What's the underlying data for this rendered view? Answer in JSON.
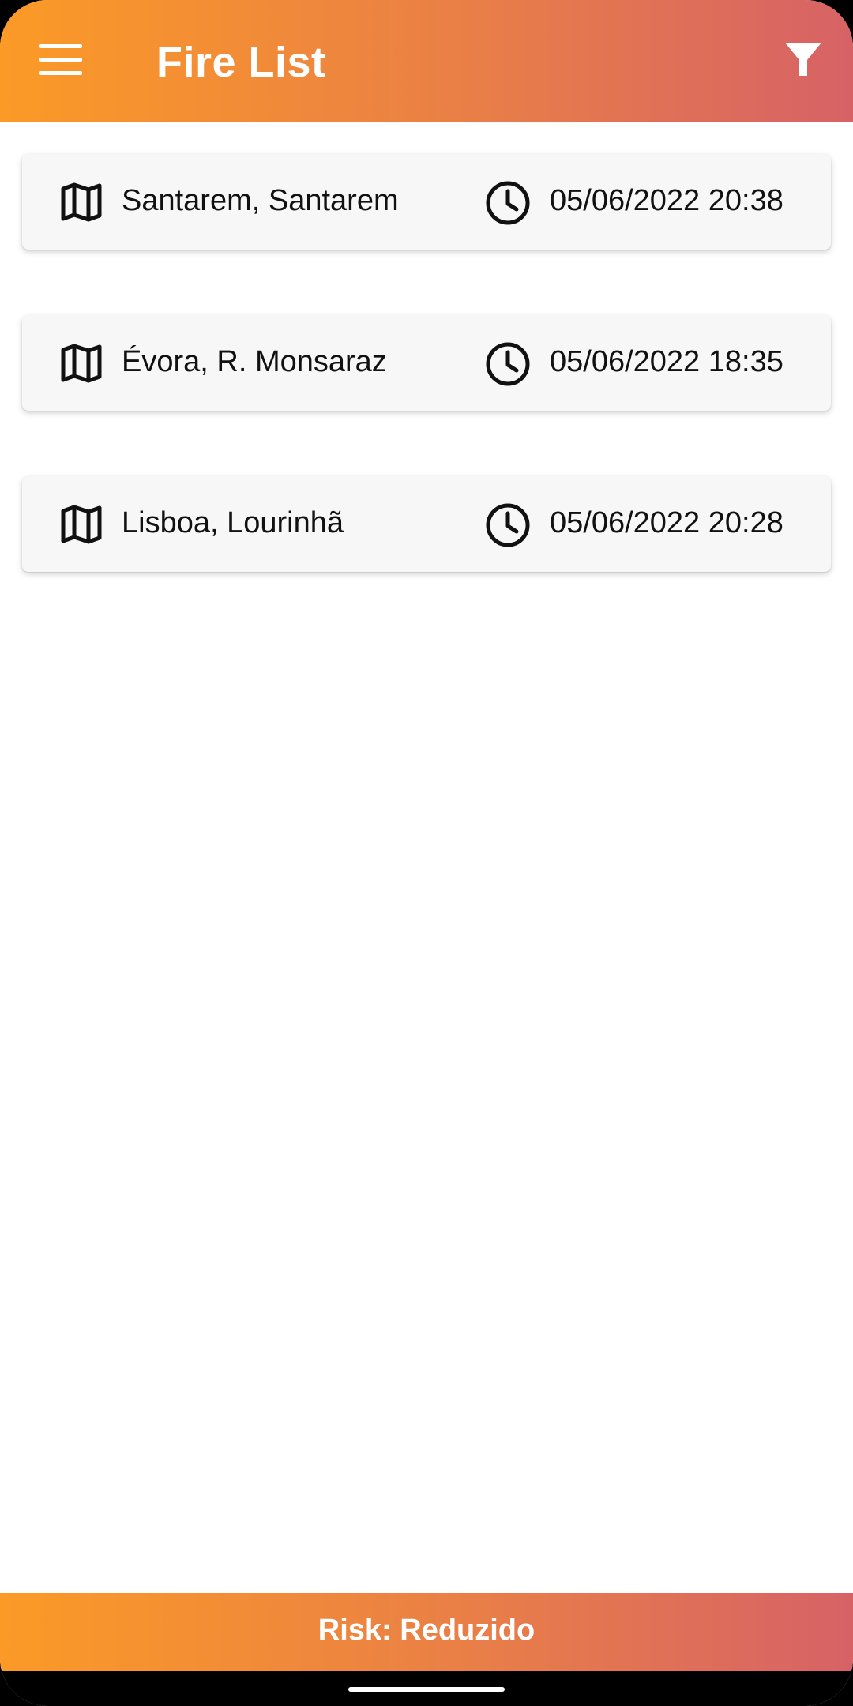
{
  "app_bar": {
    "title": "Fire List",
    "menu_icon": "hamburger-menu-icon",
    "filter_icon": "filter-funnel-icon",
    "gradient_start": "#fb9a26",
    "gradient_end": "#d76266"
  },
  "fires": [
    {
      "location": "Santarem, Santarem",
      "datetime": "05/06/2022 20:38"
    },
    {
      "location": "Évora, R. Monsaraz",
      "datetime": "05/06/2022 18:35"
    },
    {
      "location": "Lisboa, Lourinhã",
      "datetime": "05/06/2022 20:28"
    }
  ],
  "risk": {
    "label": "Risk: Reduzido"
  }
}
